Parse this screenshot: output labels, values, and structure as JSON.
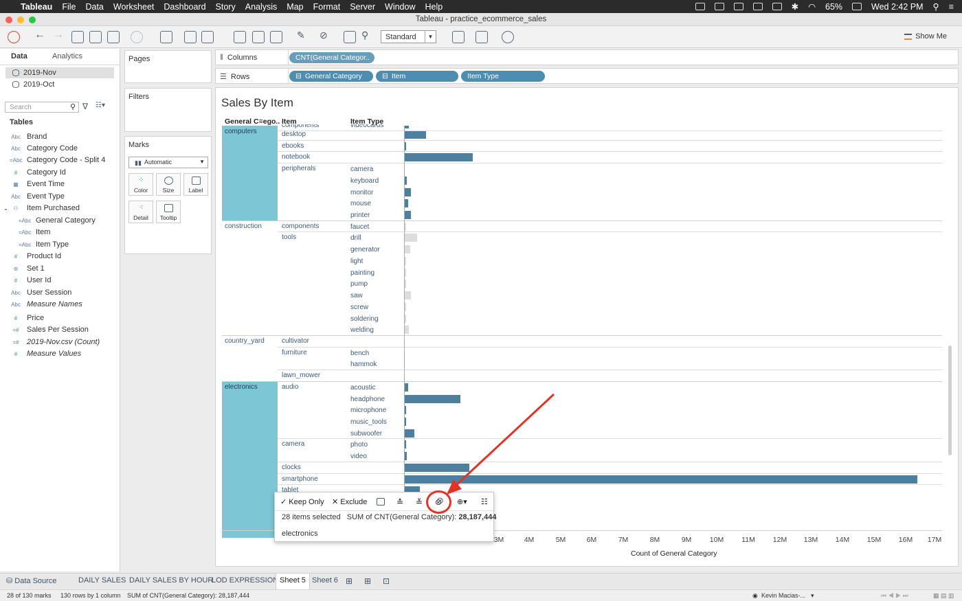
{
  "menubar": {
    "app": "Tableau",
    "items": [
      "File",
      "Data",
      "Worksheet",
      "Dashboard",
      "Story",
      "Analysis",
      "Map",
      "Format",
      "Server",
      "Window",
      "Help"
    ],
    "battery": "65%",
    "clock": "Wed 2:42 PM"
  },
  "window": {
    "title": "Tableau - practice_ecommerce_sales"
  },
  "toolbar": {
    "fit": "Standard",
    "show_me": "Show Me"
  },
  "data_pane": {
    "tabs": [
      "Data",
      "Analytics"
    ],
    "sources": [
      "2019-Nov",
      "2019-Oct"
    ],
    "search_placeholder": "Search",
    "tables_header": "Tables",
    "fields": [
      {
        "icon": "Abc",
        "name": "Brand"
      },
      {
        "icon": "Abc",
        "name": "Category Code"
      },
      {
        "icon": "=Abc",
        "name": "Category Code - Split 4"
      },
      {
        "icon": "#",
        "name": "Category Id"
      },
      {
        "icon": "cal",
        "name": "Event Time"
      },
      {
        "icon": "Abc",
        "name": "Event Type"
      },
      {
        "icon": "hier",
        "name": "Item Purchased"
      },
      {
        "icon": "=Abc",
        "name": "General Category"
      },
      {
        "icon": "=Abc",
        "name": "Item"
      },
      {
        "icon": "=Abc",
        "name": "Item Type"
      },
      {
        "icon": "#",
        "name": "Product Id"
      },
      {
        "icon": "set",
        "name": "Set 1"
      },
      {
        "icon": "#",
        "name": "User Id"
      },
      {
        "icon": "Abc",
        "name": "User Session"
      },
      {
        "icon": "Abc",
        "name": "Measure Names"
      },
      {
        "icon": "#",
        "name": "Price"
      },
      {
        "icon": "=#",
        "name": "Sales Per Session"
      },
      {
        "icon": "=#",
        "name": "2019-Nov.csv (Count)"
      },
      {
        "icon": "#",
        "name": "Measure Values"
      }
    ]
  },
  "cards": {
    "pages": "Pages",
    "filters": "Filters",
    "marks": "Marks",
    "mark_type": "Automatic",
    "mark_buttons": [
      "Color",
      "Size",
      "Label",
      "Detail",
      "Tooltip"
    ]
  },
  "shelves": {
    "columns_label": "Columns",
    "rows_label": "Rows",
    "column_pills": [
      "CNT(General Categor.."
    ],
    "row_pills": [
      "General Category",
      "Item",
      "Item Type"
    ]
  },
  "viz": {
    "title": "Sales By Item",
    "headers": [
      "General C≡ego..",
      "Item",
      "Item Type"
    ],
    "partial_label": "components",
    "partial_label2": "videocards"
  },
  "chart_data": {
    "type": "bar",
    "title": "Sales By Item",
    "xlabel": "Count of General Category",
    "x_ticks": [
      "3M",
      "4M",
      "5M",
      "6M",
      "7M",
      "8M",
      "9M",
      "10M",
      "11M",
      "12M",
      "13M",
      "14M",
      "15M",
      "16M",
      "17M"
    ],
    "xlim": [
      0,
      17400000
    ],
    "rows": [
      {
        "general": "computers",
        "item": "desktop",
        "type": "",
        "value": 680000,
        "selected": true
      },
      {
        "general": "computers",
        "item": "ebooks",
        "type": "",
        "value": 30000,
        "selected": true
      },
      {
        "general": "computers",
        "item": "notebook",
        "type": "",
        "value": 2160000,
        "selected": true
      },
      {
        "general": "computers",
        "item": "peripherals",
        "type": "camera",
        "value": 0,
        "selected": true
      },
      {
        "general": "computers",
        "item": "peripherals",
        "type": "keyboard",
        "value": 70000,
        "selected": true
      },
      {
        "general": "computers",
        "item": "peripherals",
        "type": "monitor",
        "value": 200000,
        "selected": true
      },
      {
        "general": "computers",
        "item": "peripherals",
        "type": "mouse",
        "value": 110000,
        "selected": true
      },
      {
        "general": "computers",
        "item": "peripherals",
        "type": "printer",
        "value": 200000,
        "selected": true
      },
      {
        "general": "construction",
        "item": "components",
        "type": "faucet",
        "value": 10000,
        "selected": false
      },
      {
        "general": "construction",
        "item": "tools",
        "type": "drill",
        "value": 400000,
        "selected": false
      },
      {
        "general": "construction",
        "item": "tools",
        "type": "generator",
        "value": 180000,
        "selected": false
      },
      {
        "general": "construction",
        "item": "tools",
        "type": "light",
        "value": 10000,
        "selected": false
      },
      {
        "general": "construction",
        "item": "tools",
        "type": "painting",
        "value": 10000,
        "selected": false
      },
      {
        "general": "construction",
        "item": "tools",
        "type": "pump",
        "value": 10000,
        "selected": false
      },
      {
        "general": "construction",
        "item": "tools",
        "type": "saw",
        "value": 200000,
        "selected": false
      },
      {
        "general": "construction",
        "item": "tools",
        "type": "screw",
        "value": 10000,
        "selected": false
      },
      {
        "general": "construction",
        "item": "tools",
        "type": "soldering",
        "value": 10000,
        "selected": false
      },
      {
        "general": "construction",
        "item": "tools",
        "type": "welding",
        "value": 130000,
        "selected": false
      },
      {
        "general": "country_yard",
        "item": "cultivator",
        "type": "",
        "value": 0,
        "selected": false
      },
      {
        "general": "country_yard",
        "item": "furniture",
        "type": "bench",
        "value": 0,
        "selected": false
      },
      {
        "general": "country_yard",
        "item": "furniture",
        "type": "hammok",
        "value": 0,
        "selected": false
      },
      {
        "general": "country_yard",
        "item": "lawn_mower",
        "type": "",
        "value": 0,
        "selected": false
      },
      {
        "general": "electronics",
        "item": "audio",
        "type": "acoustic",
        "value": 120000,
        "selected": true
      },
      {
        "general": "electronics",
        "item": "audio",
        "type": "headphone",
        "value": 1780000,
        "selected": true
      },
      {
        "general": "electronics",
        "item": "audio",
        "type": "microphone",
        "value": 30000,
        "selected": true
      },
      {
        "general": "electronics",
        "item": "audio",
        "type": "music_tools",
        "value": 30000,
        "selected": true
      },
      {
        "general": "electronics",
        "item": "audio",
        "type": "subwoofer",
        "value": 300000,
        "selected": true
      },
      {
        "general": "electronics",
        "item": "camera",
        "type": "photo",
        "value": 20000,
        "selected": true
      },
      {
        "general": "electronics",
        "item": "camera",
        "type": "video",
        "value": 60000,
        "selected": true
      },
      {
        "general": "electronics",
        "item": "clocks",
        "type": "",
        "value": 2050000,
        "selected": true
      },
      {
        "general": "electronics",
        "item": "smartphone",
        "type": "",
        "value": 16300000,
        "selected": true
      },
      {
        "general": "electronics",
        "item": "tablet",
        "type": "",
        "value": 480000,
        "selected": true
      }
    ]
  },
  "tooltip": {
    "keep_only": "Keep Only",
    "exclude": "Exclude",
    "selected_text": "28 items selected",
    "measure_text": "SUM of CNT(General Category):",
    "measure_value": "28,187,444",
    "value": "electronics"
  },
  "bottom_tabs": [
    "Data Source",
    "DAILY SALES",
    "DAILY SALES BY HOUR",
    "LOD EXPRESSION",
    "Sheet 5",
    "Sheet 6"
  ],
  "status": {
    "marks": "28 of 130 marks",
    "rows": "130 rows by 1 column",
    "sum": "SUM of CNT(General Category): 28,187,444",
    "user": "Kevin Macias-..."
  },
  "colors": {
    "bar": "#4c7fa0",
    "highlight": "#7cc6d6",
    "pill": "#4e8cb0",
    "annotation": "#e43325"
  }
}
